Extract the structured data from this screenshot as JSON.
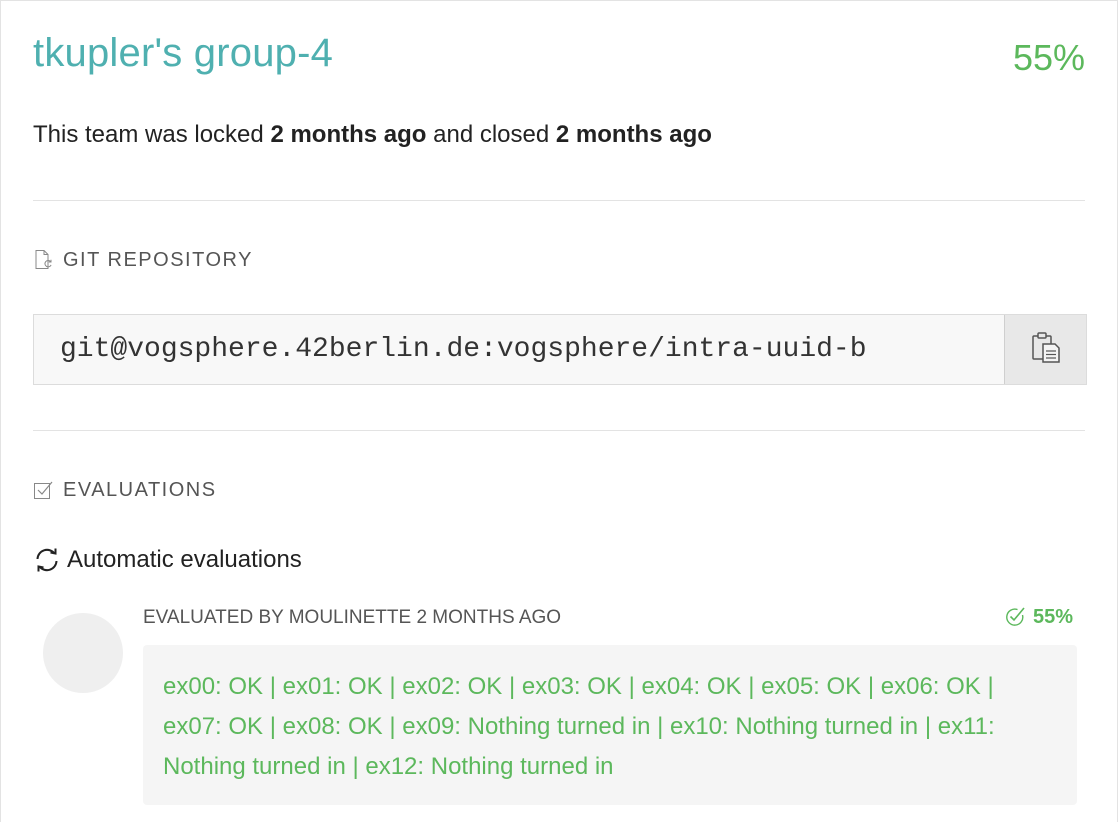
{
  "team": {
    "name": "tkupler's group-4",
    "score": "55%"
  },
  "status": {
    "prefix": "This team was locked",
    "locked_ago": "2 months ago",
    "middle": "and closed",
    "closed_ago": "2 months ago"
  },
  "repository": {
    "section_title": "GIT REPOSITORY",
    "url": "git@vogsphere.42berlin.de:vogsphere/intra-uuid-b",
    "section_icon": "file-sync-icon",
    "copy_icon": "clipboard-copy-icon"
  },
  "evaluations": {
    "section_title": "EVALUATIONS",
    "section_icon": "checkbox-icon",
    "automatic_title": "Automatic evaluations",
    "automatic_icon": "refresh-icon",
    "evaluator_line": "EVALUATED BY MOULINETTE 2 MONTHS AGO",
    "score": "55%",
    "score_icon": "check-circle-icon",
    "feedback": "ex00: OK | ex01: OK | ex02: OK | ex03: OK | ex04: OK | ex05: OK | ex06: OK | ex07: OK | ex08: OK | ex09: Nothing turned in | ex10: Nothing turned in | ex11: Nothing turned in | ex12: Nothing turned in"
  },
  "colors": {
    "title_teal": "#4fb0b0",
    "success_green": "#5cb85c"
  }
}
